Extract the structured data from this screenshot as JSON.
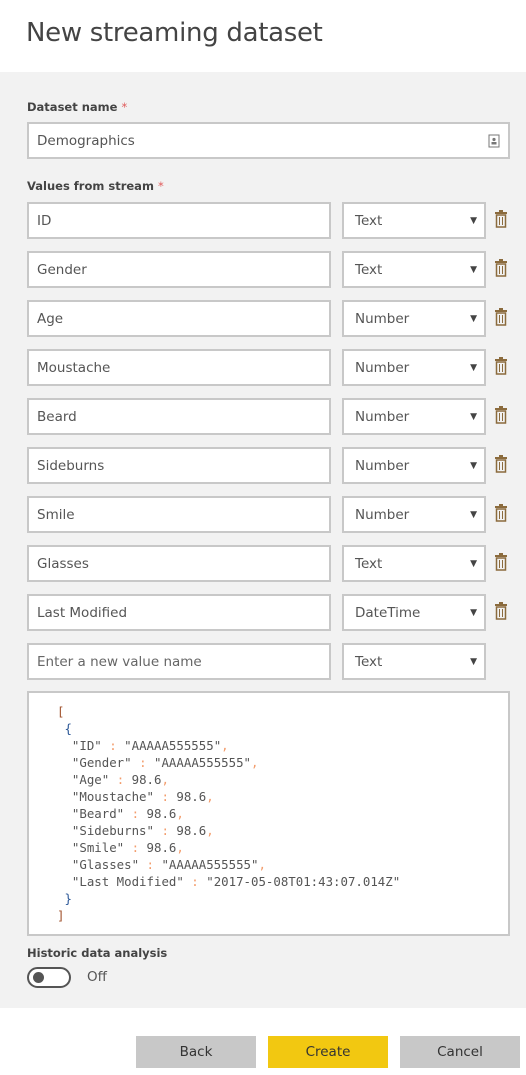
{
  "title": "New streaming dataset",
  "dataset_name": {
    "label": "Dataset name",
    "required": "*",
    "value": "Demographics",
    "icon": "contact-card-icon"
  },
  "values_label": "Values from stream",
  "values_required": "*",
  "fields": [
    {
      "name": "ID",
      "type": "Text"
    },
    {
      "name": "Gender",
      "type": "Text"
    },
    {
      "name": "Age",
      "type": "Number"
    },
    {
      "name": "Moustache",
      "type": "Number"
    },
    {
      "name": "Beard",
      "type": "Number"
    },
    {
      "name": "Sideburns",
      "type": "Number"
    },
    {
      "name": "Smile",
      "type": "Number"
    },
    {
      "name": "Glasses",
      "type": "Text"
    },
    {
      "name": "Last Modified",
      "type": "DateTime"
    }
  ],
  "new_field": {
    "placeholder": "Enter a new value name",
    "type": "Text"
  },
  "json_sample": [
    {
      "key": "\"ID\"",
      "value": "\"AAAAA555555\""
    },
    {
      "key": "\"Gender\"",
      "value": "\"AAAAA555555\""
    },
    {
      "key": "\"Age\"",
      "value": "98.6"
    },
    {
      "key": "\"Moustache\"",
      "value": "98.6"
    },
    {
      "key": "\"Beard\"",
      "value": "98.6"
    },
    {
      "key": "\"Sideburns\"",
      "value": "98.6"
    },
    {
      "key": "\"Smile\"",
      "value": "98.6"
    },
    {
      "key": "\"Glasses\"",
      "value": "\"AAAAA555555\""
    },
    {
      "key": "\"Last Modified\"",
      "value": "\"2017-05-08T01:43:07.014Z\""
    }
  ],
  "historic": {
    "label": "Historic data analysis",
    "state": "Off",
    "on": false
  },
  "buttons": {
    "back": "Back",
    "create": "Create",
    "cancel": "Cancel"
  },
  "colors": {
    "accent": "#f2c811",
    "panel": "#f2f2f2",
    "required": "#e05a5a"
  }
}
